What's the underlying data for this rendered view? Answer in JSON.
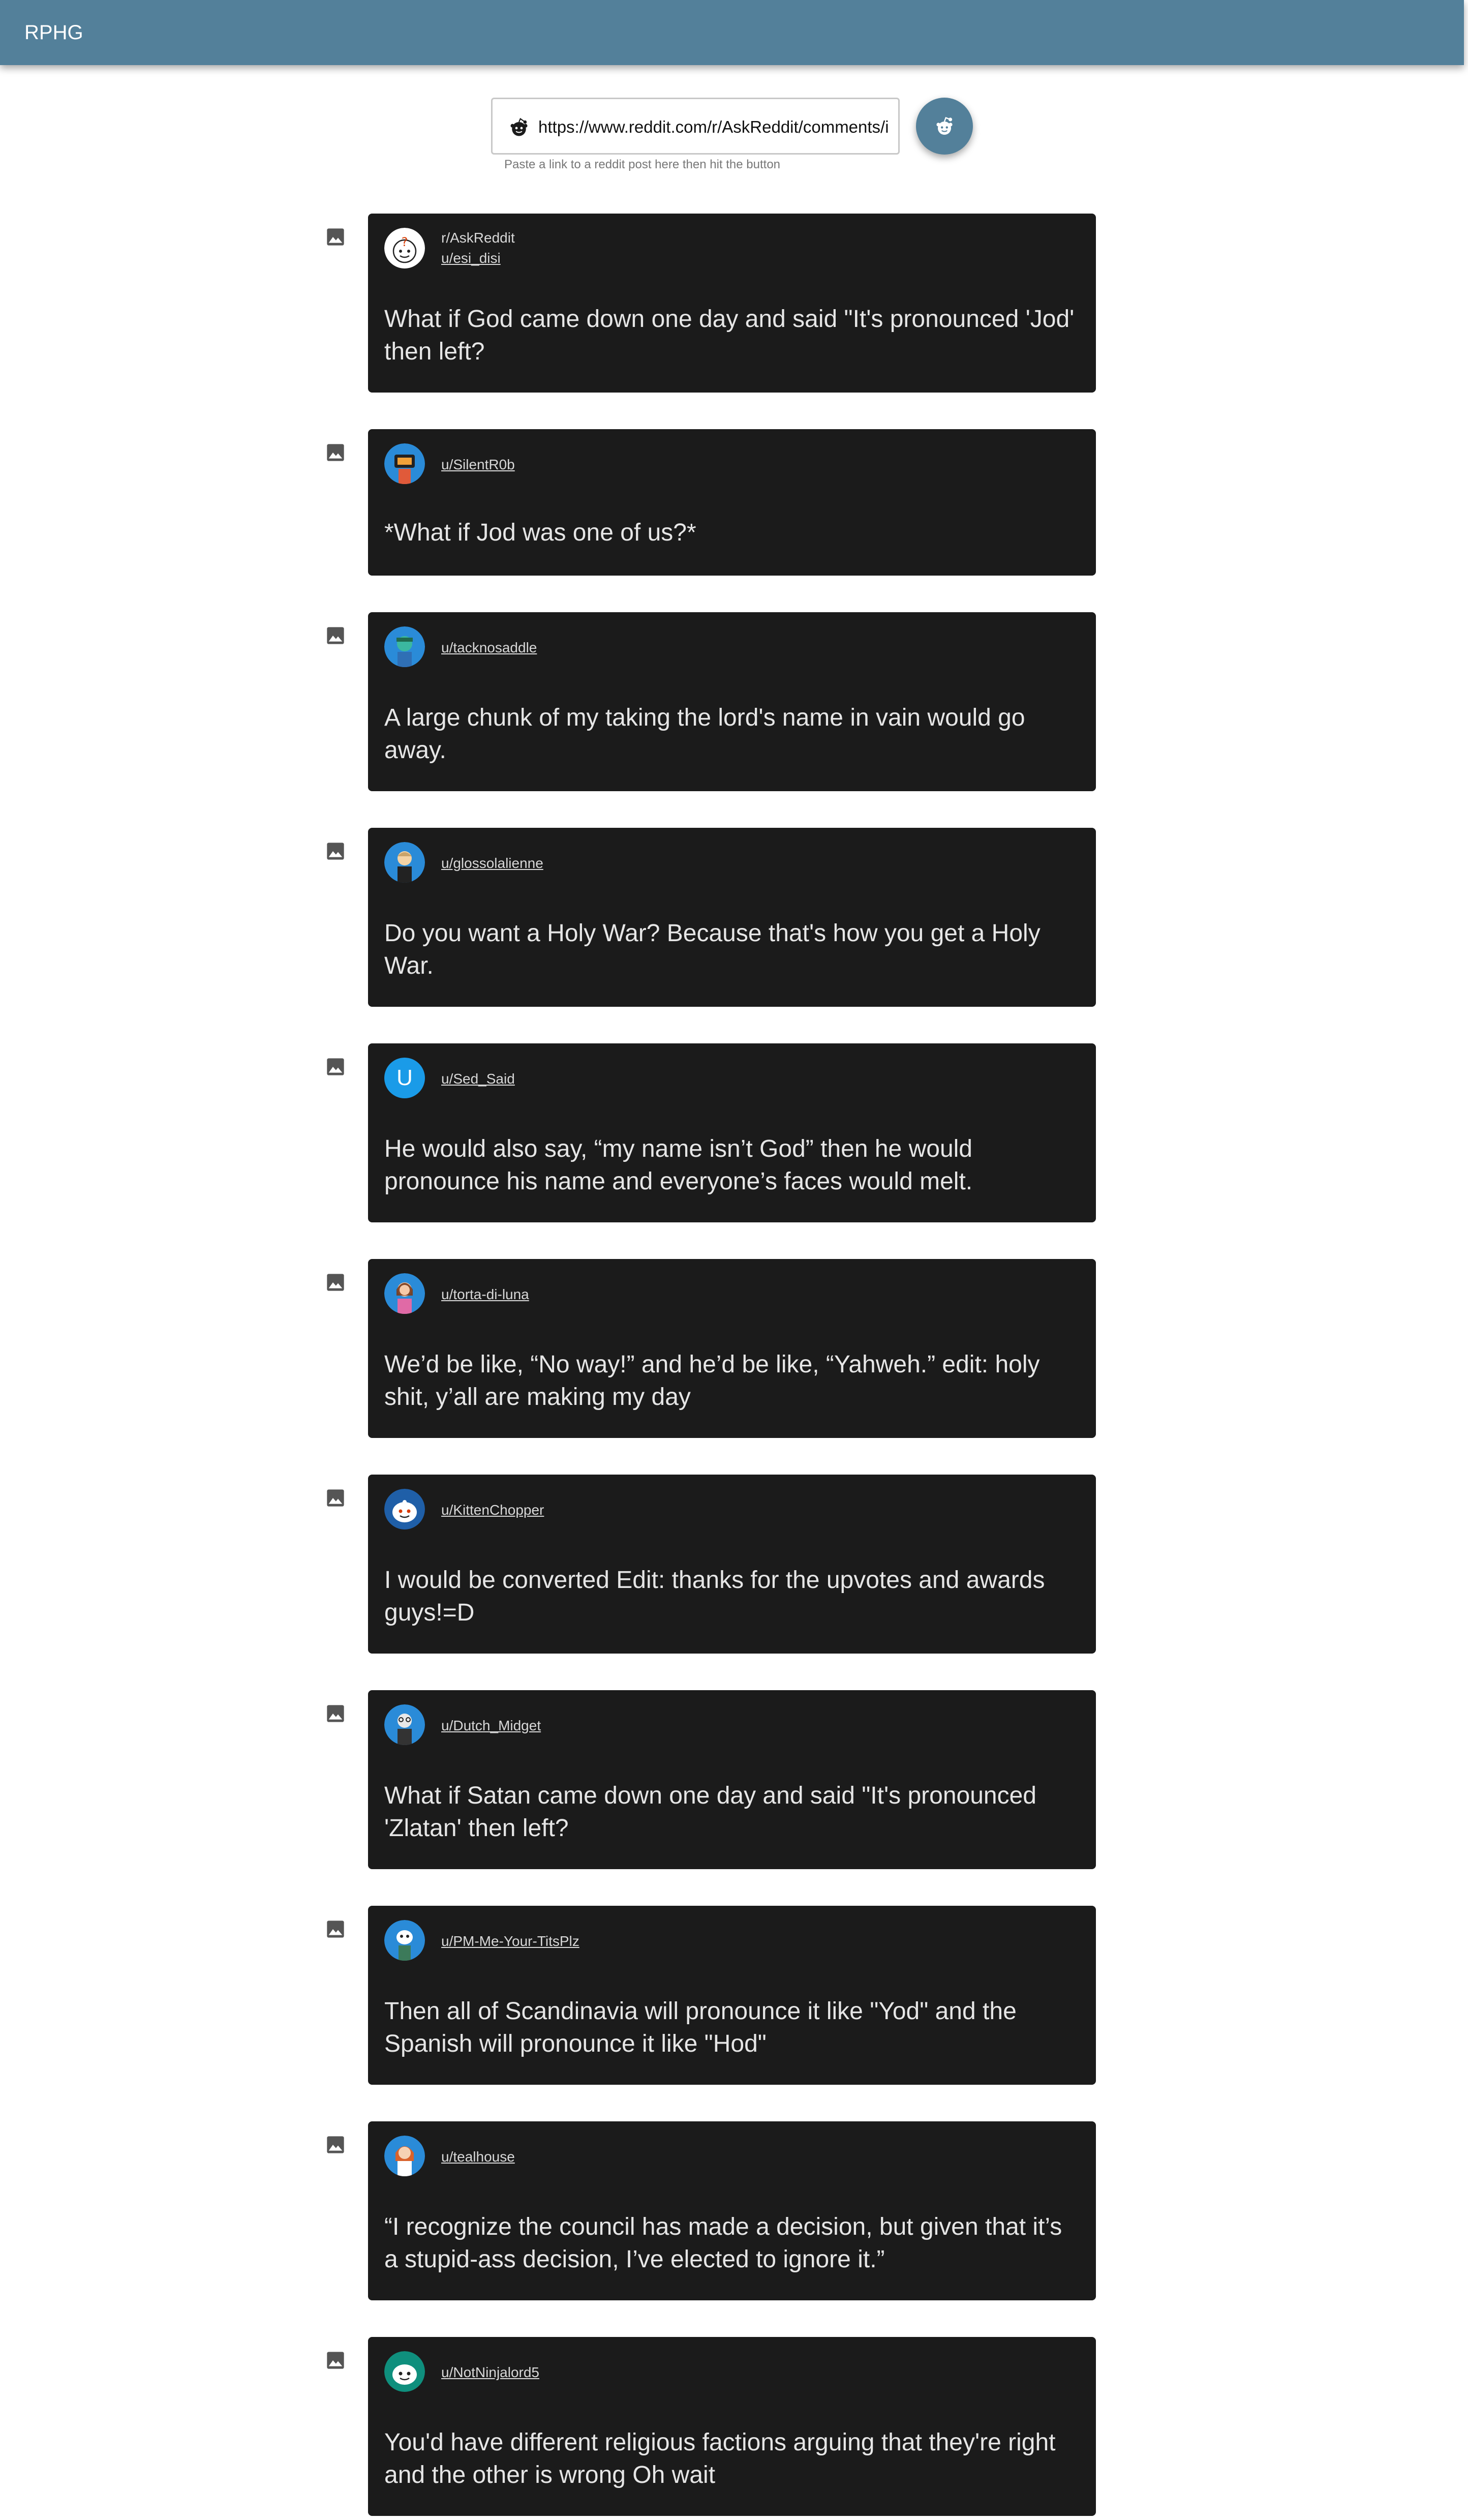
{
  "app": {
    "title": "RPHG"
  },
  "url_bar": {
    "value": "https://www.reddit.com/r/AskReddit/comments/i",
    "helper": "Paste a link to a reddit post here then hit the button"
  },
  "colors": {
    "appbar": "#53809a",
    "card": "#1b1b1b",
    "letter_avatar": "#1a9be8"
  },
  "post": {
    "subreddit": "r/AskReddit",
    "author": "u/esi_disi",
    "title": "What if God came down one day and said \"It's pronounced 'Jod' then left?"
  },
  "comments": [
    {
      "author": "u/SilentR0b",
      "text": "*What if Jod was one of us?*"
    },
    {
      "author": "u/tacknosaddle",
      "text": "A large chunk of my taking the lord's name in vain would go away."
    },
    {
      "author": "u/glossolalienne",
      "text": "Do you want a Holy War? Because that's how you get a Holy War."
    },
    {
      "author": "u/Sed_Said",
      "avatar_letter": "U",
      "text": "He would also say, “my name isn’t God” then he would pronounce his name and everyone’s faces would melt."
    },
    {
      "author": "u/torta-di-luna",
      "text": "We’d be like, “No way!” and he’d be like, “Yahweh.” edit: holy shit, y’all are making my day"
    },
    {
      "author": "u/KittenChopper",
      "text": "I would be converted Edit: thanks for the upvotes and awards guys!=D"
    },
    {
      "author": "u/Dutch_Midget",
      "text": "What if Satan came down one day and said \"It's pronounced 'Zlatan' then left?"
    },
    {
      "author": "u/PM-Me-Your-TitsPlz",
      "text": "Then all of Scandinavia will pronounce it like \"Yod\" and the Spanish will pronounce it like \"Hod\""
    },
    {
      "author": "u/tealhouse",
      "text": "“I recognize the council has made a decision, but given that it’s a stupid-ass decision, I’ve elected to ignore it.”"
    },
    {
      "author": "u/NotNinjalord5",
      "text": "You'd have different religious factions arguing that they're right and the other is wrong Oh wait"
    }
  ]
}
